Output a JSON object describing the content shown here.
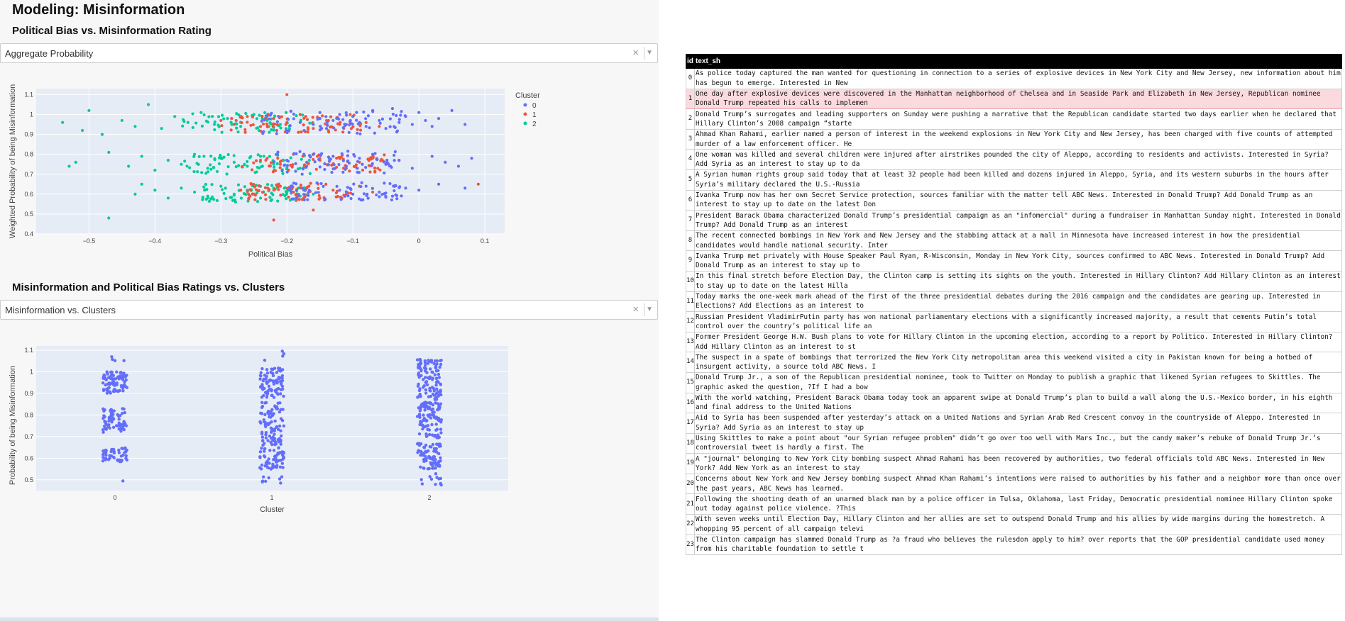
{
  "page_title": "Modeling: Misinformation",
  "section1": {
    "heading": "Political Bias vs. Misinformation Rating",
    "dropdown_value": "Aggregate Probability",
    "clear_glyph": "×",
    "arrow_glyph": "▼"
  },
  "section2": {
    "heading": "Misinformation and Political Bias Ratings vs. Clusters",
    "dropdown_value": "Misinformation vs. Clusters",
    "clear_glyph": "×",
    "arrow_glyph": "▼"
  },
  "colors": {
    "cluster0": "#636efa",
    "cluster1": "#ef553b",
    "cluster2": "#00cc96",
    "plot_bg": "#e5ecf6"
  },
  "chart_data": [
    {
      "type": "scatter",
      "xlabel": "Political Bias",
      "ylabel": "Weighted Probability of being Misinformation",
      "xlim": [
        -0.58,
        0.13
      ],
      "ylim": [
        0.4,
        1.13
      ],
      "xticks": [
        -0.5,
        -0.4,
        -0.3,
        -0.2,
        -0.1,
        0,
        0.1
      ],
      "xtick_labels": [
        "−0.5",
        "−0.4",
        "−0.3",
        "−0.2",
        "−0.1",
        "0",
        "0.1"
      ],
      "yticks": [
        0.4,
        0.5,
        0.6,
        0.7,
        0.8,
        0.9,
        1,
        1.1
      ],
      "ytick_labels": [
        "0.4",
        "0.5",
        "0.6",
        "0.7",
        "0.8",
        "0.9",
        "1",
        "1.1"
      ],
      "legend_title": "Cluster",
      "legend_position": "top-right",
      "series": [
        {
          "name": "0",
          "x": [
            -0.18,
            -0.16,
            -0.15,
            -0.14,
            -0.13,
            -0.12,
            -0.11,
            -0.1,
            -0.09,
            -0.08,
            -0.07,
            -0.06,
            -0.05,
            -0.04,
            -0.03,
            -0.02,
            -0.01,
            0,
            0.01,
            0.02,
            0.03,
            0.05,
            0.07,
            -0.2,
            -0.17,
            -0.13,
            -0.11,
            -0.09,
            -0.07,
            -0.05,
            -0.03,
            -0.01,
            0.02,
            0.04,
            0.06,
            0.08,
            -0.12,
            -0.1,
            -0.08,
            -0.06,
            -0.04,
            -0.02,
            0,
            0.03,
            0.07
          ],
          "y": [
            0.96,
            0.95,
            0.98,
            0.93,
            0.97,
            1.0,
            0.95,
            0.99,
            0.96,
            0.94,
            1.02,
            0.97,
            0.93,
            1.03,
            0.96,
            0.99,
            0.95,
            1.01,
            0.97,
            0.94,
            0.98,
            1.02,
            0.95,
            0.77,
            0.76,
            0.79,
            0.74,
            0.78,
            0.8,
            0.75,
            0.77,
            0.73,
            0.79,
            0.76,
            0.74,
            0.78,
            0.62,
            0.6,
            0.64,
            0.61,
            0.59,
            0.63,
            0.62,
            0.65,
            0.63
          ]
        },
        {
          "name": "1",
          "x": [
            -0.3,
            -0.28,
            -0.26,
            -0.24,
            -0.22,
            -0.2,
            -0.18,
            -0.16,
            -0.14,
            -0.12,
            -0.1,
            -0.08,
            -0.06,
            -0.23,
            -0.21,
            -0.19,
            -0.17,
            -0.15,
            -0.13,
            -0.11,
            -0.09,
            -0.07,
            -0.05,
            -0.03,
            0.09,
            -0.27,
            -0.25,
            -0.21,
            -0.19,
            -0.17,
            -0.15,
            -0.13,
            -0.11,
            -0.09,
            -0.07,
            -0.2,
            -0.16,
            -0.22
          ],
          "y": [
            0.97,
            0.95,
            0.99,
            0.94,
            0.98,
            0.96,
            1.0,
            0.93,
            0.97,
            0.95,
            0.99,
            0.96,
            0.94,
            0.78,
            0.75,
            0.8,
            0.74,
            0.77,
            0.79,
            0.73,
            0.76,
            0.78,
            0.75,
            0.77,
            0.65,
            0.62,
            0.6,
            0.64,
            0.61,
            0.63,
            0.58,
            0.62,
            0.6,
            0.64,
            0.61,
            1.1,
            0.52,
            0.47
          ]
        },
        {
          "name": "2",
          "x": [
            -0.54,
            -0.5,
            -0.48,
            -0.45,
            -0.43,
            -0.41,
            -0.39,
            -0.37,
            -0.35,
            -0.33,
            -0.31,
            -0.29,
            -0.27,
            -0.25,
            -0.23,
            -0.21,
            -0.52,
            -0.47,
            -0.44,
            -0.42,
            -0.4,
            -0.38,
            -0.36,
            -0.34,
            -0.32,
            -0.3,
            -0.28,
            -0.26,
            -0.24,
            -0.22,
            -0.2,
            -0.18,
            -0.43,
            -0.4,
            -0.38,
            -0.36,
            -0.34,
            -0.32,
            -0.3,
            -0.28,
            -0.26,
            -0.24,
            -0.22,
            -0.2,
            -0.18,
            -0.16,
            -0.47,
            -0.42,
            -0.53,
            -0.51
          ],
          "y": [
            0.96,
            1.02,
            0.9,
            0.97,
            0.94,
            1.05,
            0.93,
            0.99,
            0.96,
            1.01,
            0.95,
            0.98,
            0.94,
            1.0,
            0.97,
            0.95,
            0.76,
            0.81,
            0.74,
            0.79,
            0.72,
            0.77,
            0.75,
            0.8,
            0.73,
            0.78,
            0.76,
            0.74,
            0.79,
            0.75,
            0.77,
            0.73,
            0.6,
            0.62,
            0.58,
            0.63,
            0.61,
            0.59,
            0.64,
            0.6,
            0.62,
            0.58,
            0.63,
            0.61,
            0.59,
            0.6,
            0.48,
            0.65,
            0.74,
            0.92
          ]
        }
      ]
    },
    {
      "type": "strip",
      "xlabel": "Cluster",
      "ylabel": "Probability of being Misinformation",
      "categories": [
        "0",
        "1",
        "2"
      ],
      "ylim": [
        0.45,
        1.12
      ],
      "yticks": [
        0.5,
        0.6,
        0.7,
        0.8,
        0.9,
        1,
        1.1
      ],
      "ytick_labels": [
        "0.5",
        "0.6",
        "0.7",
        "0.8",
        "0.9",
        "1",
        "1.1"
      ],
      "clusters": {
        "0": [
          [
            0.9,
            1.0,
            90
          ],
          [
            0.72,
            0.83,
            70
          ],
          [
            0.58,
            0.65,
            45
          ],
          [
            1.05,
            1.1,
            4
          ],
          [
            0.48,
            0.5,
            1
          ]
        ],
        "1": [
          [
            0.88,
            1.02,
            90
          ],
          [
            0.66,
            0.86,
            90
          ],
          [
            0.55,
            0.65,
            60
          ],
          [
            0.48,
            0.52,
            8
          ],
          [
            1.05,
            1.1,
            4
          ]
        ],
        "2": [
          [
            0.87,
            1.06,
            100
          ],
          [
            0.69,
            0.86,
            100
          ],
          [
            0.55,
            0.67,
            80
          ],
          [
            0.46,
            0.54,
            12
          ]
        ]
      }
    }
  ],
  "table": {
    "headers": [
      "id",
      "text_sh"
    ],
    "selected_row": 1,
    "rows": [
      {
        "id": "0",
        "text": "As police today captured the man wanted for questioning in connection to a series of explosive devices in New York City and New Jersey, new information about him has begun to emerge. Interested in New"
      },
      {
        "id": "1",
        "text": "One day after explosive devices were discovered in the Manhattan neighborhood of Chelsea and in Seaside Park and Elizabeth in New Jersey, Republican nominee Donald Trump repeated his calls to implemen"
      },
      {
        "id": "2",
        "text": "Donald Trump’s surrogates and leading supporters on Sunday were pushing a narrative that the Republican candidate started two days earlier when he declared that Hillary Clinton’s 2008 campaign “starte"
      },
      {
        "id": "3",
        "text": "Ahmad Khan Rahami, earlier named a person of interest in the weekend explosions in New York City and New Jersey, has been charged with five counts of attempted murder of a law enforcement officer. He"
      },
      {
        "id": "4",
        "text": "One woman was killed and several children were injured after airstrikes pounded the city of Aleppo, according to residents and activists. Interested in Syria? Add Syria as an interest to stay up to da"
      },
      {
        "id": "5",
        "text": "A Syrian human rights group said today that at least 32 people had been killed and dozens injured in Aleppo, Syria, and its western suburbs in the hours after Syria’s military declared the U.S.-Russia"
      },
      {
        "id": "6",
        "text": "Ivanka Trump now has her own Secret Service protection, sources familiar with the matter tell ABC News. Interested in Donald Trump? Add Donald Trump as an interest to stay up to date on the latest Don"
      },
      {
        "id": "7",
        "text": "President Barack Obama characterized Donald Trump’s presidential campaign as an \"infomercial\" during a fundraiser in Manhattan Sunday night. Interested in Donald Trump? Add Donald Trump as an interest"
      },
      {
        "id": "8",
        "text": "The recent connected bombings in New York and New Jersey and the stabbing attack at a mall in Minnesota have increased interest in how the presidential candidates would handle national security. Inter"
      },
      {
        "id": "9",
        "text": "Ivanka Trump met privately with House Speaker Paul Ryan, R-Wisconsin, Monday in New York City, sources confirmed to ABC News. Interested in Donald Trump? Add Donald Trump as an interest to stay up to"
      },
      {
        "id": "10",
        "text": "In this final stretch before Election Day, the Clinton camp is setting its sights on the youth. Interested in Hillary Clinton? Add Hillary Clinton as an interest to stay up to date on the latest Hilla"
      },
      {
        "id": "11",
        "text": "Today marks the one-week mark ahead of the first of the three presidential debates during the 2016 campaign and the candidates are gearing up. Interested in Elections? Add Elections as an interest to"
      },
      {
        "id": "12",
        "text": "Russian President VladimirPutin party has won national parliamentary elections with a significantly increased majority, a result that cements Putin’s total control over the country’s political life an"
      },
      {
        "id": "13",
        "text": "Former President George H.W. Bush plans to vote for Hillary Clinton in the upcoming election, according to a report by Politico. Interested in Hillary Clinton? Add Hillary Clinton as an interest to st"
      },
      {
        "id": "14",
        "text": "The suspect in a spate of bombings that terrorized the New York City metropolitan area this weekend visited a city in Pakistan known for being a hotbed of insurgent activity, a source told ABC News. I"
      },
      {
        "id": "15",
        "text": "Donald Trump Jr., a son of the Republican presidential nominee, took to Twitter on Monday to publish a graphic that likened Syrian refugees to Skittles. The graphic asked the question, ?If I had a bow"
      },
      {
        "id": "16",
        "text": "With the world watching, President Barack Obama today took an apparent swipe at Donald Trump’s plan to build a wall along the U.S.-Mexico border, in his eighth and final address to the United Nations"
      },
      {
        "id": "17",
        "text": "Aid to Syria has been suspended after yesterday’s attack on a United Nations and Syrian Arab Red Crescent convoy in the countryside of Aleppo. Interested in Syria? Add Syria as an interest to stay up"
      },
      {
        "id": "18",
        "text": "Using Skittles to make a point about \"our Syrian refugee problem\" didn’t go over too well with Mars Inc., but the candy maker’s rebuke of Donald Trump Jr.’s controversial tweet is hardly a first. The"
      },
      {
        "id": "19",
        "text": "A \"journal\" belonging to New York City bombing suspect Ahmad Rahami has been recovered by authorities, two federal officials told ABC News. Interested in New York? Add New York as an interest to stay"
      },
      {
        "id": "20",
        "text": "Concerns about New York and New Jersey bombing suspect Ahmad Khan Rahami’s intentions were raised to authorities by his father and a neighbor more than once over the past years, ABC News has learned."
      },
      {
        "id": "21",
        "text": "Following the shooting death of an unarmed black man by a police officer in Tulsa, Oklahoma, last Friday, Democratic presidential nominee Hillary Clinton spoke out today against police violence. ?This"
      },
      {
        "id": "22",
        "text": "With seven weeks until Election Day, Hillary Clinton and her allies are set to outspend Donald Trump and his allies by wide margins during the homestretch. A whopping 95 percent of all campaign televi"
      },
      {
        "id": "23",
        "text": "The Clinton campaign has slammed Donald Trump as ?a fraud who believes the rulesdon apply to him? over reports that the GOP presidential candidate used money from his charitable foundation to settle t"
      }
    ]
  }
}
